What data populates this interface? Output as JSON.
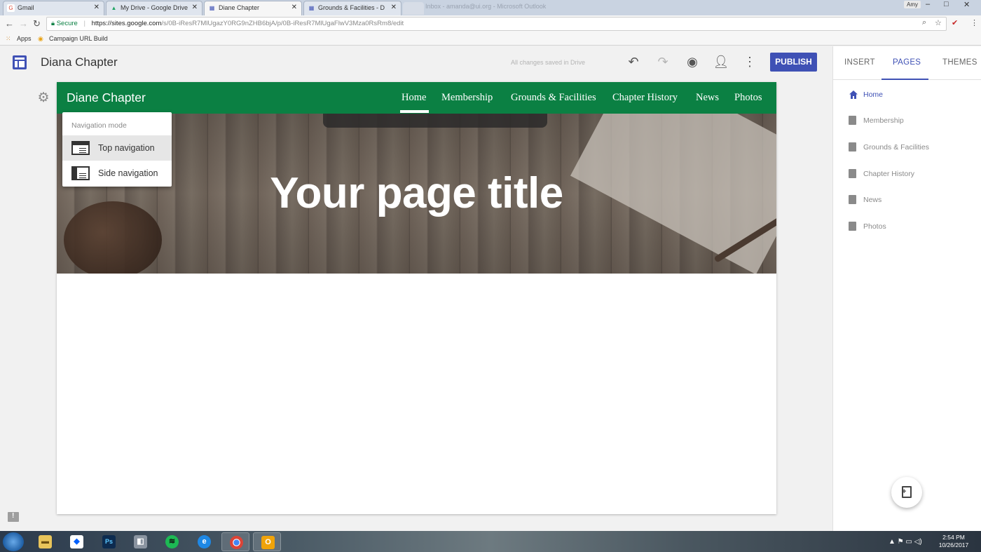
{
  "browser": {
    "tabs": [
      {
        "title": "Gmail",
        "favicon": "G",
        "color": "#dd4b39",
        "active": false
      },
      {
        "title": "My Drive - Google Drive",
        "favicon": "▲",
        "color": "#1fa463",
        "active": false
      },
      {
        "title": "Diane Chapter",
        "favicon": "▦",
        "color": "#3f51b5",
        "active": true
      },
      {
        "title": "Grounds & Facilities - D",
        "favicon": "▦",
        "color": "#3f51b5",
        "active": false
      }
    ],
    "extra_tab_text": "Inbox - amanda@ui.org - Microsoft Outlook",
    "user_chip": "Amy",
    "address": {
      "secure_label": "Secure",
      "url_host": "https://sites.google.com",
      "url_path": "/s/0B-iResR7MlUgazY0RG9nZHB6bjA/p/0B-iResR7MlUgaFlwV3Mza0RsRm8/edit"
    },
    "bookmarks": [
      {
        "label": "Apps"
      },
      {
        "label": "Campaign URL Build"
      }
    ]
  },
  "editor": {
    "title": "Diana Chapter",
    "save_status": "All changes saved in Drive",
    "publish_label": "PUBLISH"
  },
  "right_panel": {
    "tabs": [
      "INSERT",
      "PAGES",
      "THEMES"
    ],
    "active_tab": "PAGES",
    "pages": [
      "Home",
      "Membership",
      "Grounds & Facilities",
      "Chapter History",
      "News",
      "Photos"
    ],
    "active_page": "Home"
  },
  "site": {
    "name": "Diane Chapter",
    "nav": [
      "Home",
      "Membership",
      "Grounds & Facilities",
      "Chapter History",
      "News",
      "Photos"
    ],
    "active_nav": "Home",
    "header_color": "#0b8043",
    "hero_title": "Your page title"
  },
  "nav_popup": {
    "header": "Navigation mode",
    "options": [
      "Top navigation",
      "Side navigation"
    ],
    "selected": "Top navigation"
  },
  "taskbar": {
    "apps": [
      "file-explorer",
      "dropbox",
      "photoshop",
      "app",
      "spotify",
      "internet-explorer",
      "chrome",
      "outlook"
    ],
    "time": "2:54 PM",
    "date": "10/26/2017"
  },
  "colors": {
    "accent": "#3f51b5",
    "site_green": "#0b8043"
  }
}
